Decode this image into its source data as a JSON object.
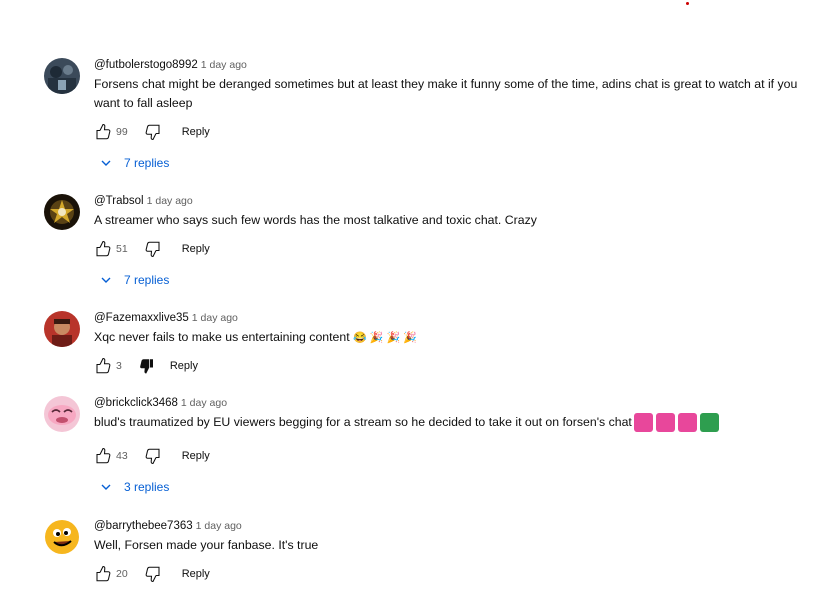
{
  "comments": [
    {
      "author": "@futbolerstogo8992",
      "time": "1 day ago",
      "text": "Forsens chat might be deranged sometimes but at least they make it funny some of the time, adins chat is great to watch at if you want to fall asleep",
      "likes": "99",
      "reply_label": "Reply",
      "replies_label": "7 replies"
    },
    {
      "author": "@Trabsol",
      "time": "1 day ago",
      "text": "A streamer who says such few words has the most talkative and toxic chat. Crazy",
      "likes": "51",
      "reply_label": "Reply",
      "replies_label": "7 replies"
    },
    {
      "author": "@Fazemaxxlive35",
      "time": "1 day ago",
      "text": "Xqc never fails to make us entertaining content",
      "emojis": "😂 🎉 🎉 🎉",
      "likes": "3",
      "reply_label": "Reply"
    },
    {
      "author": "@brickclick3468",
      "time": "1 day ago",
      "text": "blud's traumatized by EU viewers begging for a stream so he decided to take it out on forsen's chat",
      "likes": "43",
      "reply_label": "Reply",
      "replies_label": "3 replies"
    },
    {
      "author": "@barrythebee7363",
      "time": "1 day ago",
      "text": "Well, Forsen made your fanbase. It's true",
      "likes": "20",
      "reply_label": "Reply"
    }
  ],
  "colors": {
    "link_blue": "#065fd4",
    "meta_gray": "#606060",
    "text": "#0f0f0f",
    "sticker_pink": "#e8479b",
    "sticker_green": "#2e9e4f"
  },
  "icons": [
    "like-icon",
    "dislike-icon",
    "dislike-filled-icon",
    "chevron-down-icon"
  ]
}
